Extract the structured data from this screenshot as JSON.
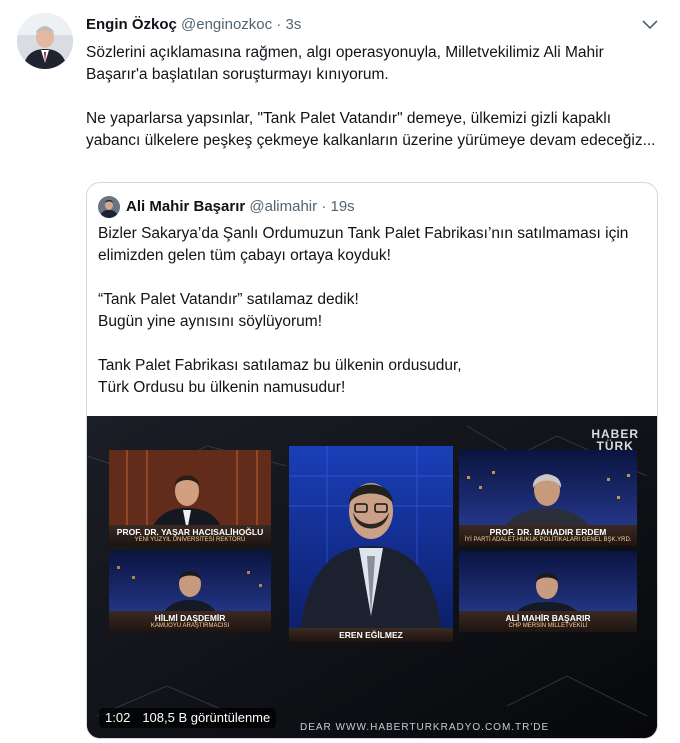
{
  "tweet": {
    "author_name": "Engin Özkoç",
    "author_handle": "@enginozkoc",
    "separator": "·",
    "time": "3s",
    "paragraph_1": "Sözlerini açıklamasına rağmen, algı operasyonuyla, Milletvekilimiz Ali Mahir Başarır'a başlatılan soruşturmayı kınıyorum.",
    "paragraph_2": "Ne yaparlarsa yapsınlar, \"Tank Palet Vatandır\" demeye, ülkemizi gizli kapaklı yabancı ülkelere peşkeş çekmeye kalkanların üzerine yürümeye devam edeceğiz..."
  },
  "quoted_tweet": {
    "author_name": "Ali Mahir Başarır",
    "author_handle": "@alimahir",
    "separator": "·",
    "time": "19s",
    "paragraph_1": "Bizler Sakarya’da Şanlı Ordumuzun Tank Palet Fabrikası’nın satılmaması için elimizden gelen tüm çabayı ortaya koyduk!",
    "paragraph_2_line_1": "“Tank Palet Vatandır” satılamaz dedik!",
    "paragraph_2_line_2": "Bugün yine aynısını söylüyorum!",
    "paragraph_3_line_1": "Tank Palet Fabrikası satılamaz bu ülkenin ordusudur,",
    "paragraph_3_line_2": "Türk Ordusu bu ülkenin namusudur!"
  },
  "video": {
    "duration": "1:02",
    "views": "108,5 B görüntülenme",
    "channel_logo_line_1": "HABER",
    "channel_logo_line_2": "TÜRK",
    "ticker": "DEAR WWW.HABERTURKRADYO.COM.TR'DE",
    "panels": [
      {
        "name": "PROF. DR. YAŞAR HACISALİHOĞLU",
        "title": "YENİ YÜZYIL ÜNİVERSİTESİ REKTÖRÜ"
      },
      {
        "name": "HİLMİ DAŞDEMİR",
        "title": "KAMUOYU ARAŞTIRMACISI"
      },
      {
        "name": "EREN EĞİLMEZ",
        "title": ""
      },
      {
        "name": "PROF. DR. BAHADIR ERDEM",
        "title": "İYİ PARTİ ADALET-HUKUK POLİTİKALARI GENEL BŞK.YRD."
      },
      {
        "name": "ALİ MAHİR BAŞARIR",
        "title": "CHP MERSİN MİLLETVEKİLİ"
      }
    ]
  },
  "colors": {
    "text": "#0f1419",
    "muted": "#536471",
    "border": "#cfd9de"
  },
  "icons": {
    "more": "chevron-down-icon"
  }
}
